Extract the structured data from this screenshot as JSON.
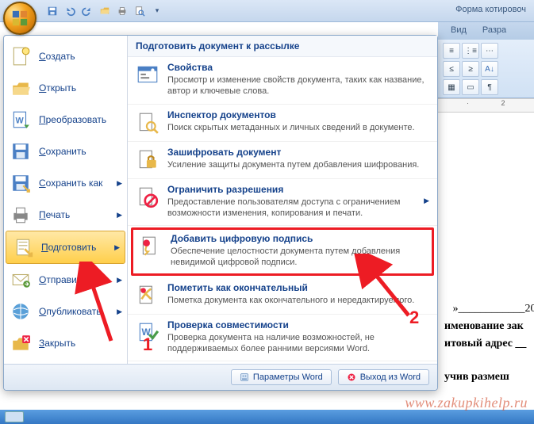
{
  "window_title": "Форма котировоч",
  "ribbon_tabs": [
    "Вид",
    "Разра"
  ],
  "ruler_marks": " · 2 · · · 1 · ",
  "qat": {
    "save": "save-icon",
    "undo": "undo-icon",
    "redo": "redo-icon",
    "open": "open-icon",
    "quickprint": "quickprint-icon",
    "preview": "preview-icon"
  },
  "left_menu": [
    {
      "icon": "new",
      "label": "Создать"
    },
    {
      "icon": "open",
      "label": "Открыть"
    },
    {
      "icon": "convert",
      "label": "Преобразовать"
    },
    {
      "icon": "save",
      "label": "Сохранить"
    },
    {
      "icon": "saveas",
      "label": "Сохранить как",
      "arrow": true
    },
    {
      "icon": "print",
      "label": "Печать",
      "arrow": true
    },
    {
      "icon": "prepare",
      "label": "Подготовить",
      "arrow": true,
      "selected": true
    },
    {
      "icon": "send",
      "label": "Отправить",
      "arrow": true
    },
    {
      "icon": "publish",
      "label": "Опубликовать",
      "arrow": true
    },
    {
      "icon": "close",
      "label": "Закрыть"
    }
  ],
  "right_header": "Подготовить документ к рассылке",
  "right_items": [
    {
      "icon": "properties",
      "title": "Свойства",
      "desc": "Просмотр и изменение свойств документа, таких как название, автор и ключевые слова."
    },
    {
      "icon": "inspect",
      "title": "Инспектор документов",
      "desc": "Поиск скрытых метаданных и личных сведений в документе."
    },
    {
      "icon": "encrypt",
      "title": "Зашифровать документ",
      "desc": "Усиление защиты документа путем добавления шифрования."
    },
    {
      "icon": "restrict",
      "title": "Ограничить разрешения",
      "desc": "Предоставление пользователям доступа с ограничением возможности изменения, копирования и печати.",
      "arrow": true
    },
    {
      "icon": "sign",
      "title": "Добавить цифровую подпись",
      "desc": "Обеспечение целостности документа путем добавления невидимой цифровой подписи.",
      "highlighted": true
    },
    {
      "icon": "final",
      "title": "Пометить как окончательный",
      "desc": "Пометка документа как окончательного и нередактируемого."
    },
    {
      "icon": "compat",
      "title": "Проверка совместимости",
      "desc": "Проверка документа на наличие возможностей, не поддерживаемых более ранними версиями Word."
    }
  ],
  "footer": {
    "options": "Параметры Word",
    "exit": "Выход из Word"
  },
  "annotations": {
    "n1": "1",
    "n2": "2"
  },
  "watermark": "www.zakupkihelp.ru",
  "doc_lines": [
    "»____________20",
    "именование зак",
    "итовый адрес __",
    "учив размеш"
  ]
}
